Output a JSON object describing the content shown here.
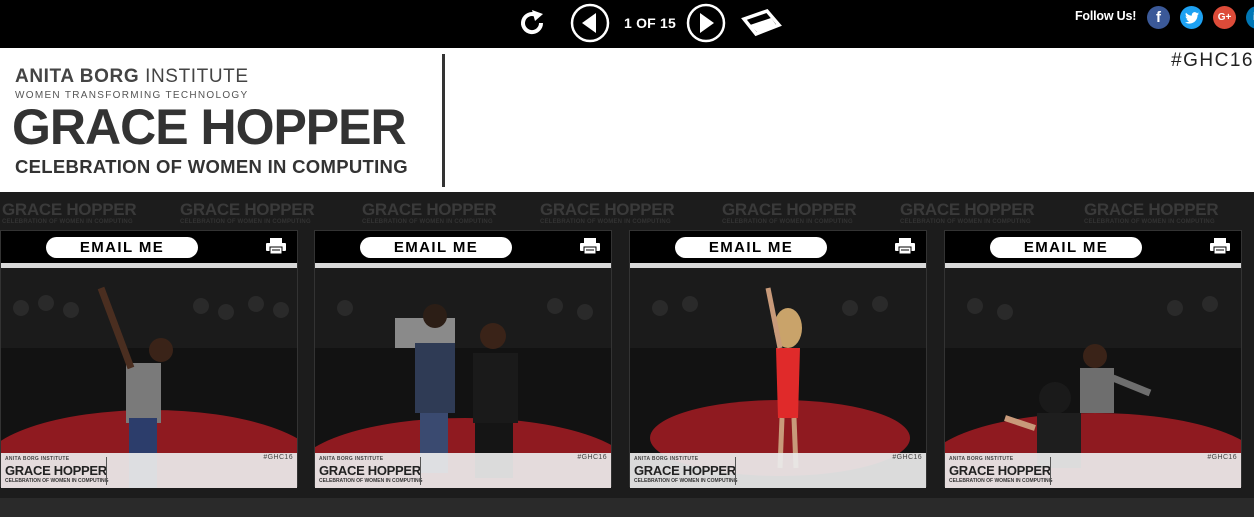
{
  "viewer": {
    "page_counter": "1 OF 15",
    "follow_label": "Follow Us!",
    "social": {
      "facebook": "f",
      "twitter": "t",
      "google": "G+",
      "linkedin": "in"
    }
  },
  "banner": {
    "org_bold": "ANITA BORG",
    "org_rest": " INSTITUTE",
    "tagline": "WOMEN TRANSFORMING TECHNOLOGY",
    "title": "GRACE HOPPER",
    "subtitle": "CELEBRATION OF WOMEN IN COMPUTING",
    "hashtag": "#GHC16"
  },
  "watermark": {
    "title": "GRACE HOPPER",
    "subtitle": "CELEBRATION OF WOMEN IN COMPUTING"
  },
  "photos": [
    {
      "email_label": "EMAIL ME"
    },
    {
      "email_label": "EMAIL ME"
    },
    {
      "email_label": "EMAIL ME"
    },
    {
      "email_label": "EMAIL ME"
    }
  ],
  "photo_footer": {
    "org": "ANITA BORG INSTITUTE",
    "title": "GRACE HOPPER",
    "subtitle": "CELEBRATION OF WOMEN IN COMPUTING",
    "hashtag": "#GHC16"
  },
  "colors": {
    "facebook": "#3b5998",
    "twitter": "#1da1f2",
    "google": "#dd4b39",
    "linkedin": "#0077b5",
    "carpet": "#9e1b22"
  }
}
